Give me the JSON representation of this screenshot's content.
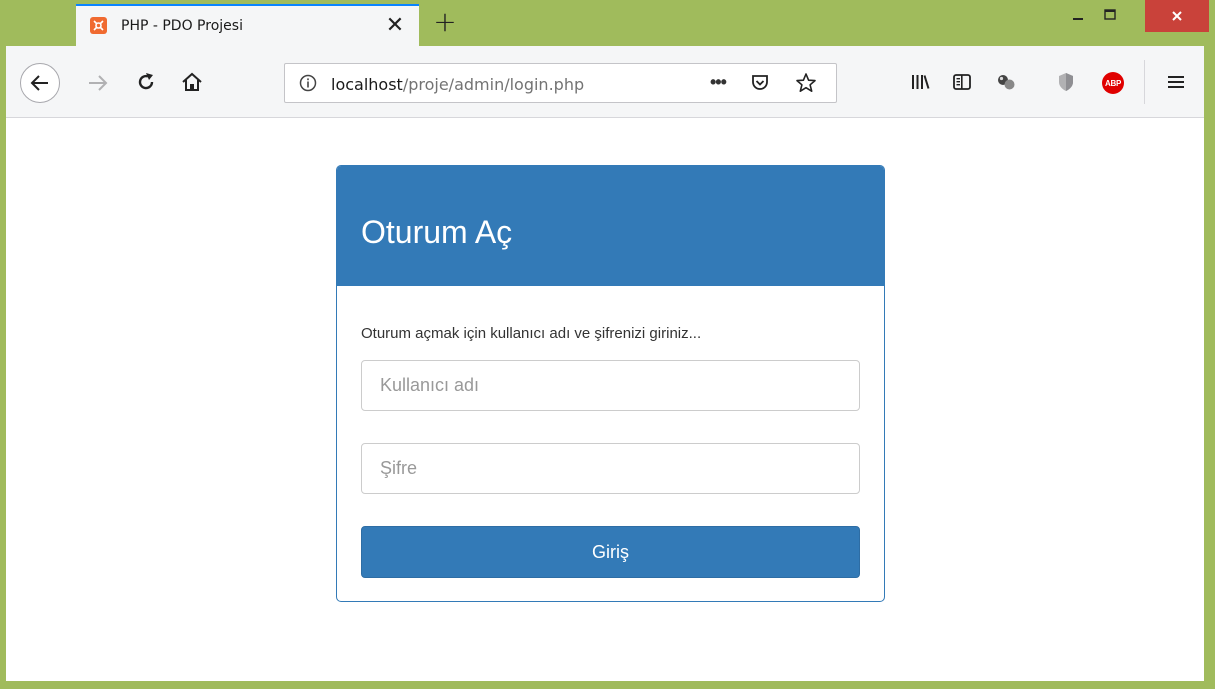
{
  "browser": {
    "tab": {
      "title": "PHP - PDO Projesi",
      "close_glyph": "✕",
      "favicon": "xampp-icon"
    },
    "new_tab_glyph": "+",
    "window_controls": {
      "minimize_glyph": "–",
      "maximize_glyph": "☐",
      "close_glyph": "✕"
    },
    "url": {
      "host": "localhost",
      "path": "/proje/admin/login.php",
      "more_glyph": "•••"
    },
    "toolbar_icons": [
      "back-icon",
      "forward-icon",
      "reload-icon",
      "home-icon",
      "library-icon",
      "sidebar-icon",
      "extension-icon",
      "shield-icon",
      "adblock-icon",
      "menu-icon"
    ],
    "abp_label": "ABP",
    "colors": {
      "frame": "#a0bb5c",
      "tab_accent": "#0a84ff",
      "close_button": "#c9423a"
    }
  },
  "login": {
    "title": "Oturum Aç",
    "intro": "Oturum açmak için kullanıcı adı ve şifrenizi giriniz...",
    "username_placeholder": "Kullanıcı adı",
    "password_placeholder": "Şifre",
    "submit_label": "Giriş",
    "colors": {
      "primary": "#337ab7"
    }
  }
}
